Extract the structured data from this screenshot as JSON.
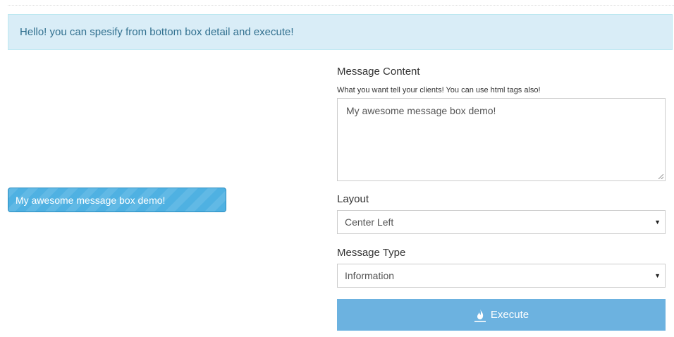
{
  "alert": {
    "text": "Hello! you can spesify from bottom box detail and execute!"
  },
  "preview": {
    "text": "My awesome message box demo!"
  },
  "form": {
    "content_label": "Message Content",
    "content_help": "What you want tell your clients! You can use html tags also!",
    "content_value": "My awesome message box demo!",
    "layout_label": "Layout",
    "layout_value": "Center Left",
    "type_label": "Message Type",
    "type_value": "Information",
    "execute_label": "Execute",
    "execute_icon": "fire-icon"
  },
  "colors": {
    "alert_bg": "#d9edf7",
    "alert_text": "#31708f",
    "preview_bg": "#4fb1e2",
    "execute_bg": "#6cb2e0"
  }
}
